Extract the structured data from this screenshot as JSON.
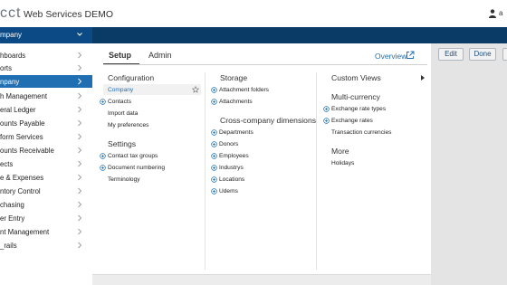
{
  "header": {
    "logo_text": "cct",
    "title": "Web Services DEMO",
    "user_initial": "a"
  },
  "navbar": {
    "company_label": "mpany"
  },
  "toolbar": {
    "edit_label": "Edit",
    "done_label": "Done"
  },
  "sidebar": {
    "items": [
      {
        "label": "hboards"
      },
      {
        "label": "orts"
      },
      {
        "label": "npany"
      },
      {
        "label": "h Management"
      },
      {
        "label": "eral Ledger"
      },
      {
        "label": "ounts Payable"
      },
      {
        "label": "form Services"
      },
      {
        "label": "ounts Receivable"
      },
      {
        "label": "ects"
      },
      {
        "label": "e & Expenses"
      },
      {
        "label": "ntory Control"
      },
      {
        "label": "chasing"
      },
      {
        "label": "er Entry"
      },
      {
        "label": "nt Management"
      },
      {
        "label": "_rails"
      }
    ]
  },
  "panel": {
    "tabs": [
      "Setup",
      "Admin"
    ],
    "overview_label": "Overview",
    "columns": {
      "configuration": {
        "title": "Configuration",
        "items": [
          "Company",
          "Contacts",
          "Import data",
          "My preferences"
        ]
      },
      "settings": {
        "title": "Settings",
        "items": [
          "Contact tax groups",
          "Document numbering",
          "Terminology"
        ]
      },
      "storage": {
        "title": "Storage",
        "items": [
          "Attachment folders",
          "Attachments"
        ]
      },
      "dimensions": {
        "title": "Cross-company dimensions",
        "items": [
          "Departments",
          "Donors",
          "Employees",
          "Industrys",
          "Locations",
          "Udems"
        ]
      },
      "custom_views": {
        "title": "Custom Views"
      },
      "multicurrency": {
        "title": "Multi-currency",
        "items": [
          "Exchange rate types",
          "Exchange rates",
          "Transaction currencies"
        ]
      },
      "more": {
        "title": "More",
        "items": [
          "Holidays"
        ]
      }
    }
  },
  "colors": {
    "navbar": "#0a3a66",
    "active_item": "#1f6fb2",
    "link": "#1f6fb2"
  }
}
